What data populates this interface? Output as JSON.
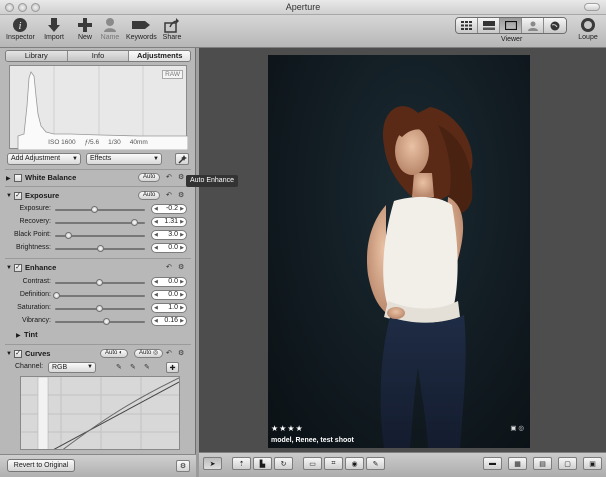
{
  "window": {
    "title": "Aperture"
  },
  "toolbar": {
    "inspector": "Inspector",
    "import": "Import",
    "new": "New",
    "name": "Name",
    "keywords": "Keywords",
    "share": "Share",
    "viewer": "Viewer",
    "loupe": "Loupe"
  },
  "tabs": [
    "Library",
    "Info",
    "Adjustments"
  ],
  "histogram": {
    "badge": "RAW",
    "iso": "ISO 1600",
    "aperture": "ƒ/5.6",
    "shutter": "1/30",
    "focal": "40mm"
  },
  "adjust_controls": {
    "add_adjustment": "Add Adjustment",
    "effects": "Effects",
    "tooltip": "Auto Enhance"
  },
  "white_balance": {
    "title": "White Balance",
    "auto": "Auto"
  },
  "exposure": {
    "title": "Exposure",
    "auto": "Auto",
    "rows": [
      {
        "label": "Exposure:",
        "value": "-0.2"
      },
      {
        "label": "Recovery:",
        "value": "1.31"
      },
      {
        "label": "Black Point:",
        "value": "3.0"
      },
      {
        "label": "Brightness:",
        "value": "0.0"
      }
    ]
  },
  "enhance": {
    "title": "Enhance",
    "rows": [
      {
        "label": "Contrast:",
        "value": "0.0"
      },
      {
        "label": "Definition:",
        "value": "0.0"
      },
      {
        "label": "Saturation:",
        "value": "1.0"
      },
      {
        "label": "Vibrancy:",
        "value": "0.16"
      }
    ],
    "tint": "Tint"
  },
  "curves": {
    "title": "Curves",
    "auto1": "Auto",
    "auto2": "Auto",
    "channel_label": "Channel:",
    "channel_value": "RGB"
  },
  "panel_bottom": {
    "revert": "Revert to Original"
  },
  "photo": {
    "rating": "★★★★",
    "caption": "model, Renee, test shoot"
  }
}
